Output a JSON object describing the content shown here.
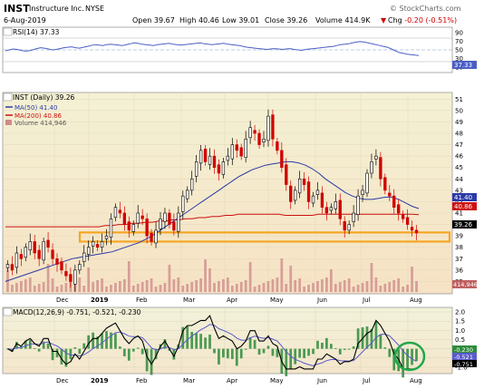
{
  "header": {
    "symbol": "INST",
    "company": "Instructure Inc.",
    "exchange": "NYSE",
    "date": "6-Aug-2019",
    "open_label": "Open",
    "open": "39.67",
    "high_label": "High",
    "high": "40.46",
    "low_label": "Low",
    "low": "39.01",
    "close_label": "Close",
    "close": "39.26",
    "volume_label": "Volume",
    "volume": "414.9K",
    "chg_label": "Chg",
    "chg": "-0.20 (-0.51%)",
    "chg_arrow": "▼",
    "source": "© StockCharts.com"
  },
  "rsi": {
    "label": "RSI(14) 37.33",
    "current": "37.33",
    "ticks": [
      "90",
      "70",
      "50",
      "30",
      "10"
    ],
    "values": [
      48,
      50,
      52,
      51,
      49,
      47,
      48,
      50,
      53,
      55,
      54,
      52,
      50,
      51,
      53,
      55,
      56,
      57,
      55,
      54,
      56,
      58,
      60,
      62,
      61,
      60,
      62,
      63,
      62,
      61,
      60,
      62,
      64,
      66,
      65,
      63,
      62,
      61,
      60,
      62,
      63,
      64,
      65,
      63,
      62,
      61,
      62,
      63,
      64,
      65,
      66,
      64,
      63,
      62,
      63,
      64,
      65,
      63,
      62,
      61,
      60,
      58,
      56,
      55,
      54,
      53,
      52,
      51,
      52,
      53,
      52,
      51,
      52,
      53,
      51,
      50,
      49,
      51,
      52,
      53,
      54,
      55,
      56,
      57,
      58,
      60,
      62,
      63,
      64,
      66,
      68,
      69,
      68,
      66,
      64,
      62,
      60,
      58,
      56,
      52,
      48,
      44,
      42,
      40,
      39,
      38,
      37
    ]
  },
  "price_panel": {
    "title": "INST (Daily) 39.26",
    "ma50_label": "MA(50) 41.40",
    "ma200_label": "MA(200) 40.86",
    "volume_label": "Volume 414,946",
    "y_ticks": [
      "51",
      "50",
      "49",
      "48",
      "47",
      "46",
      "45",
      "44",
      "43",
      "42",
      "41",
      "40",
      "39",
      "38",
      "37",
      "36",
      "35"
    ],
    "right_labels": {
      "ma50": "41.40",
      "ma200": "40.86",
      "close": "39.26",
      "volume": "414,946"
    }
  },
  "macd": {
    "label": "MACD(12,26,9) -0.751, -0.521, -0.230",
    "ticks": [
      "2.0",
      "1.5",
      "1.0",
      "0.5",
      "0.0",
      "-0.5",
      "-1.0"
    ],
    "right_labels": [
      "-0.230",
      "-0.521",
      "-0.751"
    ]
  },
  "x_labels": [
    "Dec",
    "2019",
    "Feb",
    "Mar",
    "Apr",
    "May",
    "Jun",
    "Jul",
    "Aug"
  ],
  "colors": {
    "price_bg_top": "#f5f0cc",
    "price_bg_bottom": "#f7e6c8",
    "up_candle": "#000000",
    "down_candle": "#d00000",
    "ma50": "#2b3aa8",
    "ma200": "#cc1111",
    "volume": "#d08c8c",
    "highlight": "#f5a623",
    "circle": "#22a84a",
    "rsi_line": "#4a5fc4",
    "macd_line": "#000000",
    "signal_line": "#5b5bcc",
    "hist_pos": "#2e8b3b",
    "hist_neg": "#2e8b3b"
  },
  "chart_data": {
    "type": "line",
    "title": "INST (Daily) 39.26",
    "xlabel": "",
    "ylabel": "",
    "ylim": [
      34,
      51.5
    ],
    "x_categories": [
      "Dec",
      "2019",
      "Feb",
      "Mar",
      "Apr",
      "May",
      "Jun",
      "Jul",
      "Aug"
    ],
    "series": [
      {
        "name": "INST",
        "values": [
          36.5,
          36.0,
          37.5,
          37.0,
          38.0,
          38.5,
          37.5,
          37.0,
          38.5,
          38.0,
          37.0,
          36.5,
          36.0,
          35.5,
          35.0,
          36.0,
          36.5,
          37.5,
          38.0,
          38.5,
          38.0,
          38.5,
          39.0,
          40.5,
          41.5,
          41.0,
          40.0,
          39.5,
          40.0,
          41.0,
          40.5,
          39.0,
          38.5,
          39.5,
          40.5,
          41.0,
          40.0,
          39.5,
          41.0,
          42.5,
          43.0,
          44.0,
          45.5,
          46.5,
          45.5,
          46.0,
          45.0,
          44.5,
          45.5,
          46.0,
          47.0,
          46.5,
          46.0,
          47.5,
          48.5,
          48.0,
          47.0,
          47.5,
          49.5,
          47.5,
          46.5,
          45.0,
          43.5,
          42.0,
          43.0,
          44.0,
          43.5,
          42.0,
          42.5,
          43.0,
          41.5,
          41.0,
          41.5,
          42.0,
          40.5,
          39.5,
          40.0,
          41.0,
          42.5,
          43.0,
          44.5,
          45.5,
          46.0,
          44.0,
          43.0,
          42.5,
          41.5,
          41.0,
          40.5,
          40.0,
          39.5,
          39.26
        ]
      },
      {
        "name": "MA(50)",
        "values": [
          35.0,
          35.2,
          35.4,
          35.6,
          35.8,
          36.0,
          36.2,
          36.4,
          36.6,
          36.8,
          37.0,
          37.1,
          37.2,
          37.3,
          37.4,
          37.5,
          37.6,
          37.8,
          38.0,
          38.2,
          38.4,
          38.7,
          39.0,
          39.4,
          39.8,
          40.2,
          40.6,
          41.0,
          41.4,
          41.8,
          42.2,
          42.6,
          43.0,
          43.4,
          43.8,
          44.2,
          44.5,
          44.8,
          45.0,
          45.2,
          45.3,
          45.4,
          45.5,
          45.5,
          45.4,
          45.2,
          44.9,
          44.5,
          44.0,
          43.6,
          43.2,
          42.8,
          42.5,
          42.3,
          42.2,
          42.2,
          42.3,
          42.4,
          42.4,
          42.2,
          41.9,
          41.6,
          41.4
        ]
      },
      {
        "name": "MA(200)",
        "values": [
          39.8,
          39.8,
          39.8,
          39.8,
          39.8,
          39.8,
          39.8,
          39.8,
          39.8,
          39.8,
          39.8,
          39.8,
          39.8,
          39.8,
          39.8,
          39.9,
          39.9,
          40.0,
          40.0,
          40.1,
          40.1,
          40.2,
          40.2,
          40.3,
          40.3,
          40.4,
          40.4,
          40.5,
          40.5,
          40.6,
          40.6,
          40.7,
          40.7,
          40.8,
          40.8,
          40.9,
          40.9,
          40.9,
          40.9,
          40.9,
          40.9,
          40.9,
          40.8,
          40.8,
          40.8,
          40.8,
          40.8,
          40.9,
          40.9,
          40.9,
          40.9,
          40.9,
          40.9,
          40.9,
          40.9,
          40.9,
          40.9,
          40.9,
          40.9,
          40.9,
          40.9,
          40.9,
          40.86
        ]
      }
    ],
    "highlight_range": [
      38.5,
      39.3
    ]
  }
}
